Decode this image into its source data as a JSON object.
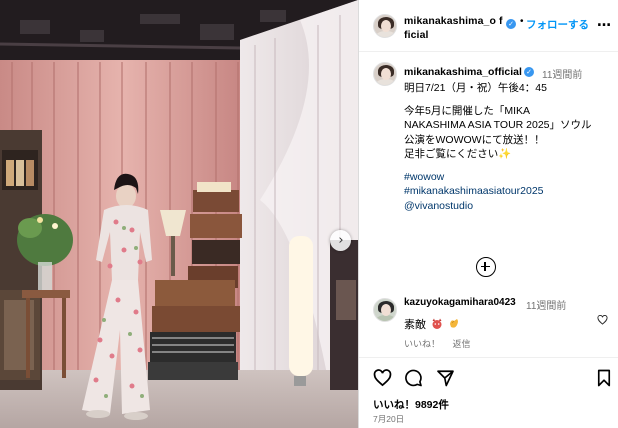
{
  "post": {
    "username": "mikanakashima_official",
    "header_username": "mikanakashima_o fficial",
    "dot": "•",
    "follow_label": "フォローする",
    "more_icon": "…",
    "verified_glyph": "✓"
  },
  "caption": {
    "username": "mikanakashima_official",
    "time": "11週間前",
    "lines": [
      "明日7/21（月・祝）午後4：45",
      "",
      "今年5月に開催した「MIKA",
      "NAKASHIMA ASIA TOUR 2025」ソウル",
      "公演をWOWOWにて放送！！",
      "足非ご覧にください✨",
      ""
    ],
    "hashtags": [
      "#wowow",
      "#mikanakashimaasiatour2025",
      "@vivanostudio"
    ]
  },
  "comment": {
    "username": "kazuyokagamihara0423",
    "time": "11週間前",
    "text": "素敵",
    "like_label": "いいね！",
    "reply_label": "返信"
  },
  "footer": {
    "likes": "いいね！9892件",
    "date": "7月20日"
  },
  "colors": {
    "accent": "#0095f6",
    "verified": "#3897f0",
    "hashtag": "#00376b",
    "muted": "#737373"
  },
  "icons": {
    "carousel_next": "›",
    "actions": [
      "heart-icon",
      "comment-icon",
      "share-icon",
      "bookmark-icon"
    ]
  }
}
